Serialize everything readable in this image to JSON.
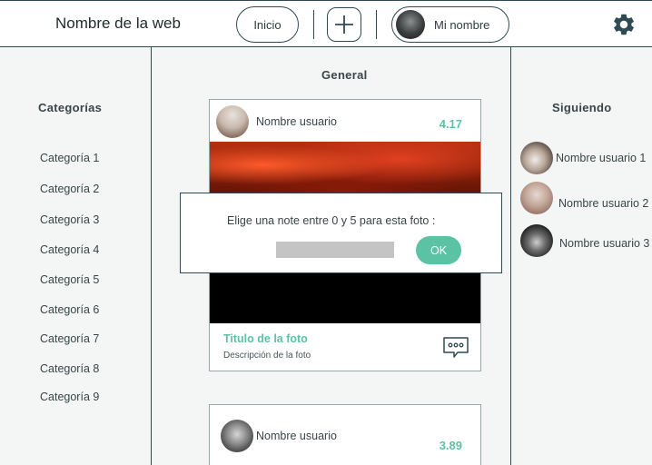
{
  "header": {
    "site_name": "Nombre de la web",
    "home_label": "Inicio",
    "add_icon": "plus-icon",
    "user_label": "Mi nombre",
    "settings_icon": "gear-icon"
  },
  "categories": {
    "title": "Categorías",
    "items": [
      "Categoría 1",
      "Categoría 2",
      "Categoría 3",
      "Categoría 4",
      "Categoría 5",
      "Categoría 6",
      "Categoría 7",
      "Categoría 8",
      "Categoría 9"
    ]
  },
  "feed": {
    "title": "General",
    "posts": [
      {
        "user": "Nombre usuario",
        "score": "4.17",
        "photo_title": "Titulo de la foto",
        "photo_description": "Descripción de la foto"
      },
      {
        "user": "Nombre usuario",
        "score": "3.89"
      }
    ]
  },
  "following": {
    "title": "Siguiendo",
    "users": [
      "Nombre usuario 1",
      "Nombre usuario 2",
      "Nombre usuario 3"
    ]
  },
  "rating_modal": {
    "prompt": "Elige una note entre 0 y 5 para esta foto :",
    "input_value": "",
    "ok_label": "OK"
  },
  "colors": {
    "accent": "#5cc2a4",
    "border": "#2f4a52",
    "background": "#f4f5f5"
  }
}
